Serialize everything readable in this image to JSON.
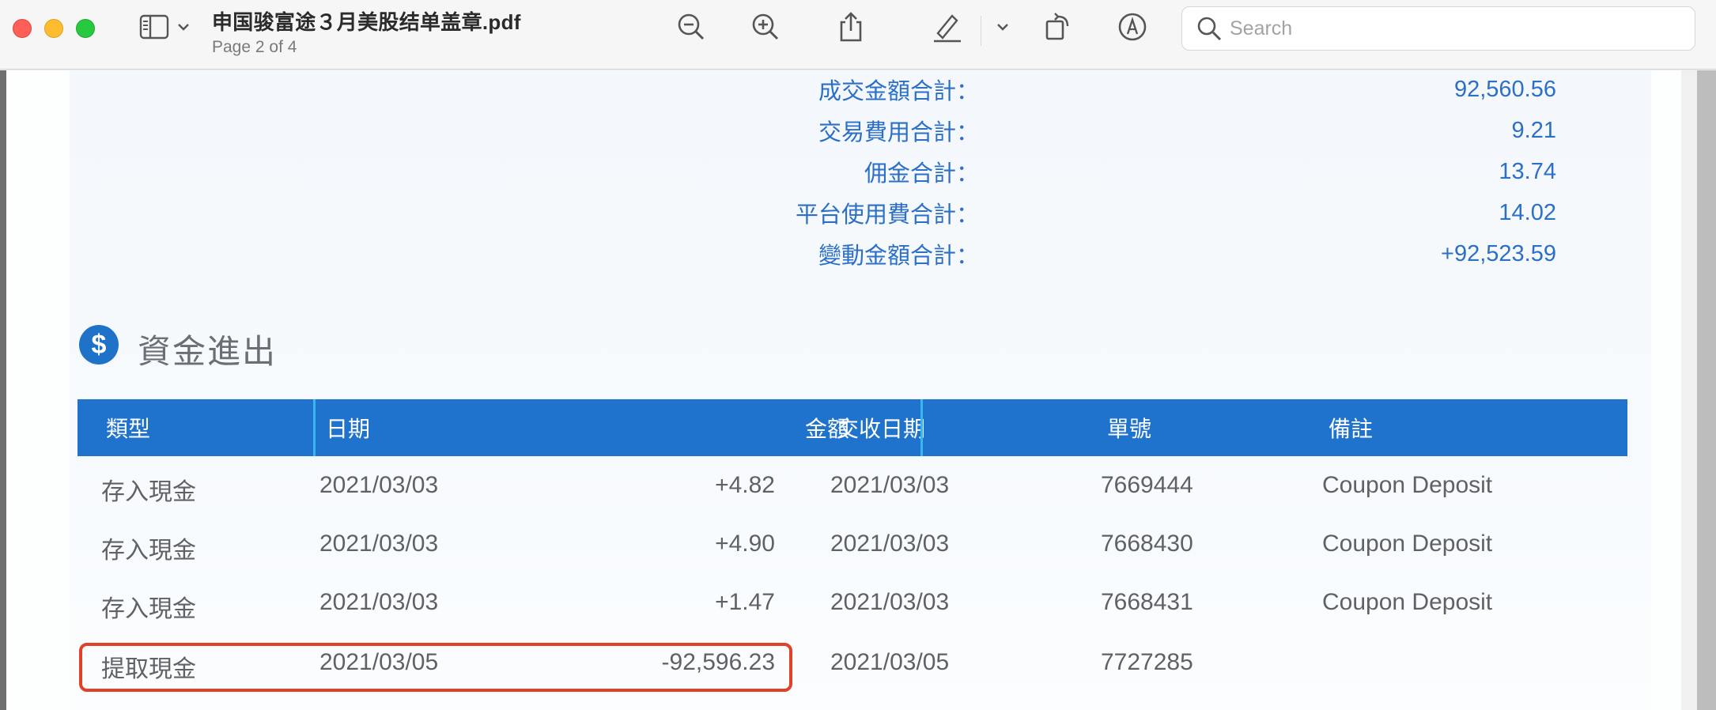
{
  "window": {
    "title": "申国骏富途３月美股结单盖章.pdf",
    "subtitle": "Page 2 of 4"
  },
  "search": {
    "placeholder": "Search"
  },
  "summary": [
    {
      "label": "成交金額合計：",
      "value": "92,560.56"
    },
    {
      "label": "交易費用合計：",
      "value": "9.21"
    },
    {
      "label": "佣金合計：",
      "value": "13.74"
    },
    {
      "label": "平台使用費合計：",
      "value": "14.02"
    },
    {
      "label": "變動金額合計：",
      "value": "+92,523.59"
    }
  ],
  "section": {
    "icon_text": "$",
    "title": "資金進出"
  },
  "table": {
    "headers": [
      "類型",
      "日期",
      "金額",
      "交收日期",
      "單號",
      "備註"
    ],
    "rows": [
      [
        "存入現金",
        "2021/03/03",
        "+4.82",
        "2021/03/03",
        "7669444",
        "Coupon Deposit"
      ],
      [
        "存入現金",
        "2021/03/03",
        "+4.90",
        "2021/03/03",
        "7668430",
        "Coupon Deposit"
      ],
      [
        "存入現金",
        "2021/03/03",
        "+1.47",
        "2021/03/03",
        "7668431",
        "Coupon Deposit"
      ],
      [
        "提取現金",
        "2021/03/05",
        "-92,596.23",
        "2021/03/05",
        "7727285",
        ""
      ]
    ]
  },
  "colors": {
    "accent_blue": "#1f73cc",
    "summary_text": "#2b6fc7",
    "highlight_red": "#e0412a"
  },
  "icons": [
    "sidebar-icon",
    "chevron-down-icon",
    "zoom-out-icon",
    "zoom-in-icon",
    "share-icon",
    "highlighter-icon",
    "rotate-icon",
    "markup-icon",
    "search-icon",
    "dollar-icon"
  ]
}
